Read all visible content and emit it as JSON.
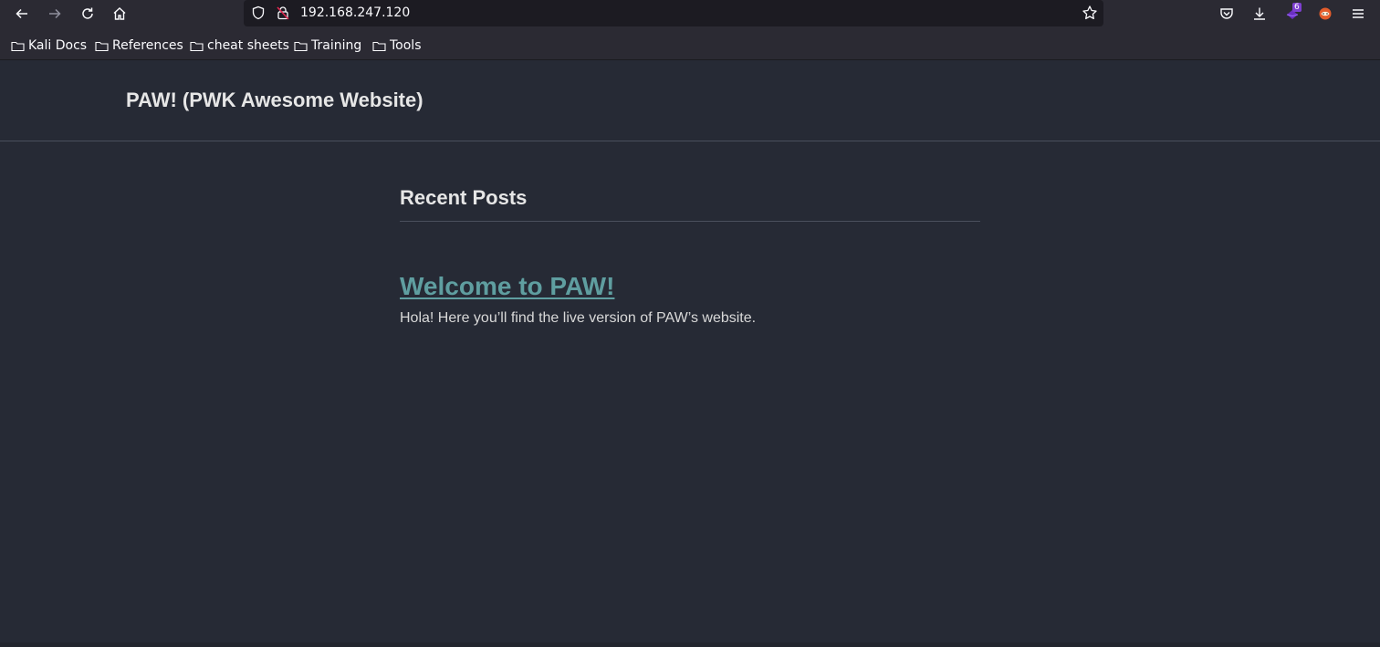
{
  "browser": {
    "url": "192.168.247.120",
    "extensions_badge": "6",
    "bookmarks": [
      "Kali Docs",
      "References",
      "cheat sheets",
      "Training",
      "Tools"
    ]
  },
  "site": {
    "title": "PAW! (PWK Awesome Website)",
    "section_title": "Recent Posts",
    "posts": [
      {
        "title": "Welcome to PAW!",
        "excerpt": "Hola! Here you’ll find the live version of PAW’s website."
      }
    ]
  },
  "colors": {
    "background": "#262a35",
    "link": "#5f9ea0",
    "text": "#e6e6e6"
  }
}
